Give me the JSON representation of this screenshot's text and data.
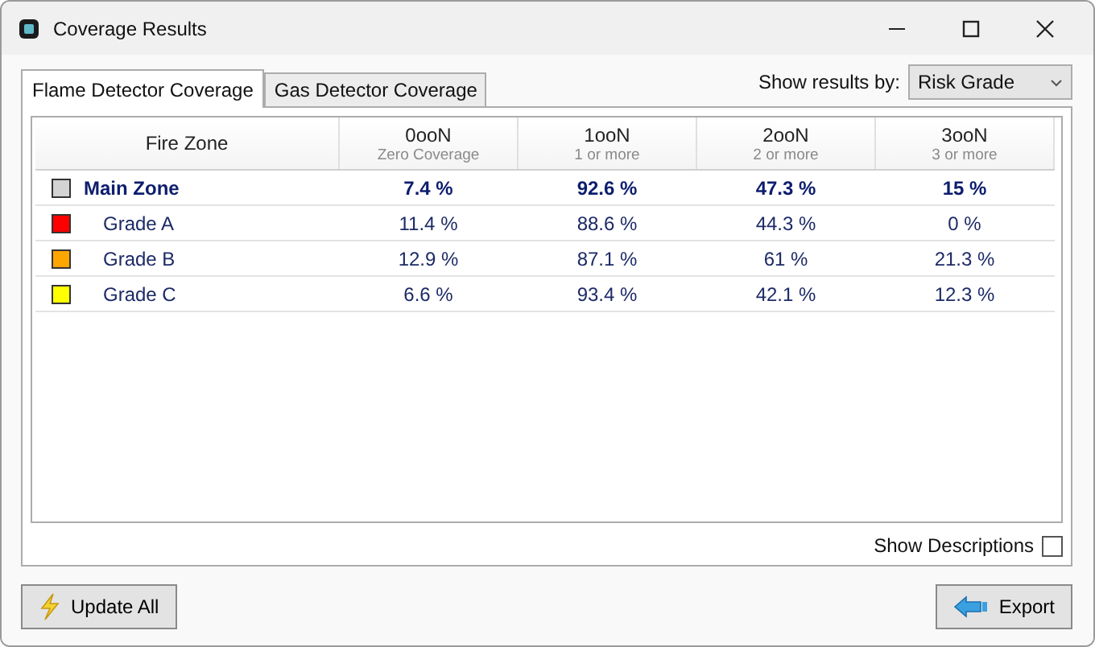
{
  "window": {
    "title": "Coverage Results"
  },
  "tabs": [
    {
      "label": "Flame Detector Coverage",
      "selected": true
    },
    {
      "label": "Gas Detector Coverage",
      "selected": false
    }
  ],
  "show_results_by": {
    "label": "Show results by:",
    "value": "Risk Grade"
  },
  "table": {
    "columns": [
      {
        "title": "Fire Zone"
      },
      {
        "title": "0ooN",
        "subtitle": "Zero Coverage"
      },
      {
        "title": "1ooN",
        "subtitle": "1 or more"
      },
      {
        "title": "2ooN",
        "subtitle": "2 or more"
      },
      {
        "title": "3ooN",
        "subtitle": "3 or more"
      }
    ],
    "rows": [
      {
        "kind": "group",
        "color": "#d3d3d3",
        "cells": [
          "Main Zone",
          "7.4 %",
          "92.6 %",
          "47.3 %",
          "15 %"
        ]
      },
      {
        "kind": "item",
        "color": "#ff0000",
        "cells": [
          "Grade A",
          "11.4 %",
          "88.6 %",
          "44.3 %",
          "0 %"
        ]
      },
      {
        "kind": "item",
        "color": "#ffa500",
        "cells": [
          "Grade B",
          "12.9 %",
          "87.1 %",
          "61 %",
          "21.3 %"
        ]
      },
      {
        "kind": "item",
        "color": "#ffff00",
        "cells": [
          "Grade C",
          "6.6 %",
          "93.4 %",
          "42.1 %",
          "12.3 %"
        ]
      }
    ]
  },
  "show_descriptions": {
    "label": "Show Descriptions",
    "checked": false
  },
  "buttons": [
    {
      "label": "Update All",
      "kind": "update"
    },
    {
      "label": "Export",
      "kind": "export"
    }
  ]
}
